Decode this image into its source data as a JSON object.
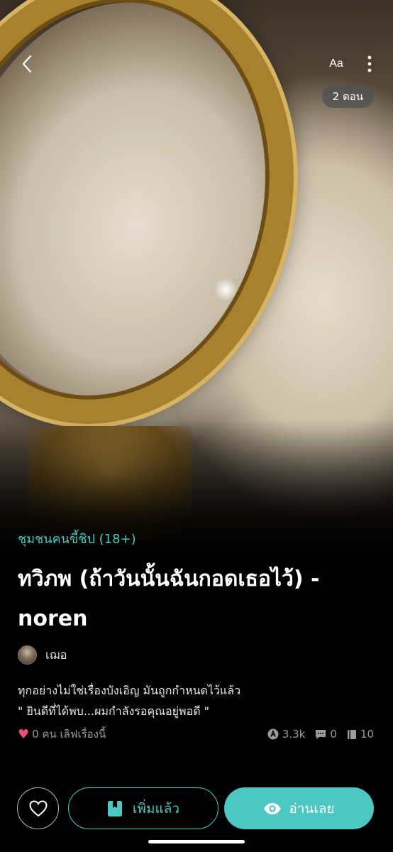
{
  "header": {
    "font_size_label": "Aa",
    "episodes_label": "2 ตอน"
  },
  "story": {
    "community": "ชุมชนคนขี้ชิป (18+)",
    "title": "ทวิภพ (ถ้าวันนั้นฉันกอดเธอไว้) - noren",
    "author": "เฌอ",
    "synopsis_line1": "ทุกอย่างไม่ใช่เรื่องบังเอิญ มันถูกกำหนดไว้แล้ว",
    "synopsis_line2": "\" ยินดีที่ได้พบ...ผมกำลังรอคุณอยู่พอดี \""
  },
  "stats": {
    "likes_text": "0 คน เลิฟเรื่องนี้",
    "views": "3.3k",
    "comments": "0",
    "chapters": "10"
  },
  "actions": {
    "added_label": "เพิ่มแล้ว",
    "read_label": "อ่านเลย"
  },
  "colors": {
    "accent": "#4cc7c1",
    "heart": "#e9507a",
    "background": "#000000"
  },
  "icons": {
    "back": "chevron-left-icon",
    "more": "more-vertical-icon",
    "like": "heart-outline-icon",
    "added": "bookmark-icon",
    "read": "eye-icon"
  }
}
